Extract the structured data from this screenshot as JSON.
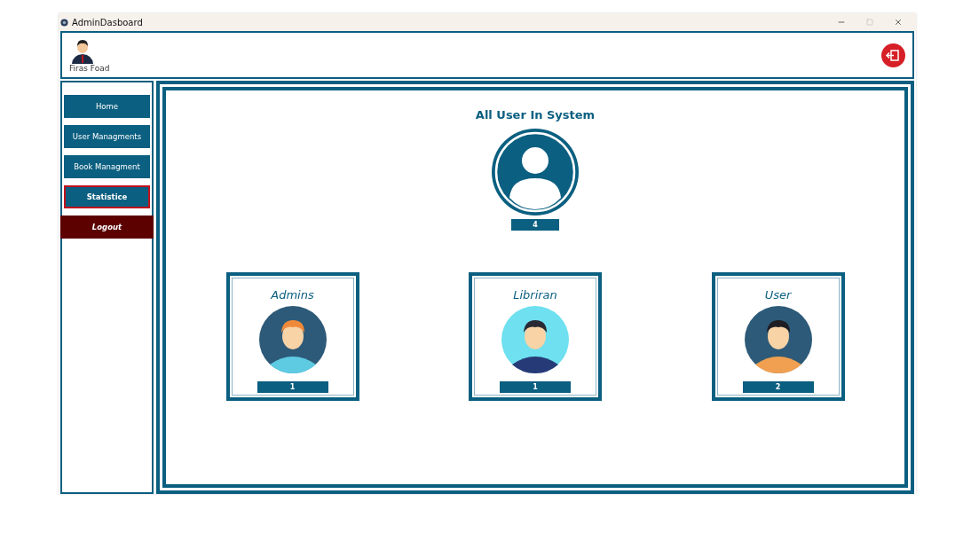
{
  "window": {
    "title": "AdminDasboard"
  },
  "header": {
    "user_name": "Firas Foad"
  },
  "sidebar": {
    "items": [
      {
        "label": "Home",
        "kind": "nav",
        "selected": false
      },
      {
        "label": "User Managments",
        "kind": "nav",
        "selected": false
      },
      {
        "label": "Book Managment",
        "kind": "nav",
        "selected": false
      },
      {
        "label": "Statistice",
        "kind": "nav",
        "selected": true
      },
      {
        "label": "Logout",
        "kind": "logout",
        "selected": false
      }
    ]
  },
  "summary": {
    "title": "All User In System",
    "count": "4"
  },
  "cards": [
    {
      "title": "Admins",
      "count": "1",
      "kind": "admin"
    },
    {
      "title": "Libriran",
      "count": "1",
      "kind": "librarian"
    },
    {
      "title": "User",
      "count": "2",
      "kind": "user"
    }
  ]
}
